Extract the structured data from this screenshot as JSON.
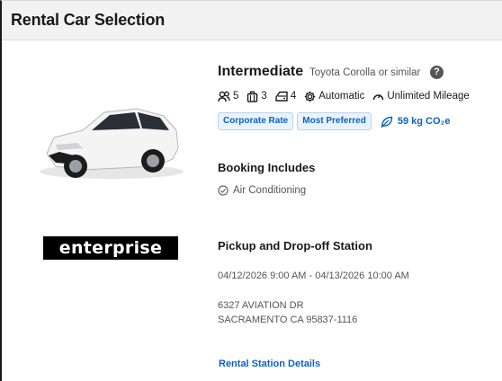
{
  "header": {
    "title": "Rental Car Selection"
  },
  "car": {
    "class": "Intermediate",
    "model": "Toyota Corolla or similar",
    "help_icon": "question-circle-icon",
    "image_icon": "white-sedan-car-image",
    "features": {
      "passengers": "5",
      "large_bags": "3",
      "doors": "4",
      "transmission": "Automatic",
      "mileage": "Unlimited Mileage"
    },
    "badges": [
      "Corporate Rate",
      "Most Preferred"
    ],
    "co2": "59 kg CO₂e"
  },
  "vendor": {
    "name": "enterprise",
    "colors": {
      "background": "#000000",
      "accent": "#2fa84f",
      "text": "#ffffff"
    }
  },
  "booking": {
    "heading": "Booking Includes",
    "items": [
      "Air Conditioning"
    ]
  },
  "pickup": {
    "heading": "Pickup and Drop-off Station",
    "dates": "04/12/2026 9:00 AM - 04/13/2026 10:00 AM",
    "address_line1": "6327 AVIATION DR",
    "address_line2": "SACRAMENTO CA 95837-1116",
    "details_link": "Rental Station Details"
  },
  "colors": {
    "link": "#0b62c4",
    "badge_bg": "#eaf3fc",
    "header_bg": "#f2f2f2"
  }
}
